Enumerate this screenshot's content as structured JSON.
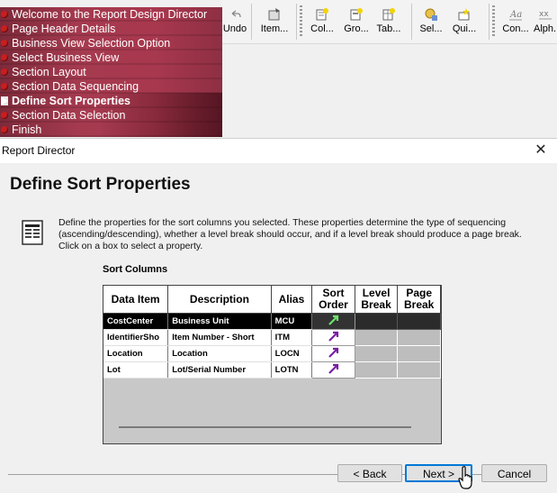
{
  "toolbar": {
    "buttons": [
      {
        "label": "Undo",
        "icon": "undo-icon"
      },
      {
        "label": "Item...",
        "icon": "item-icon"
      },
      {
        "label": "Col...",
        "icon": "columnar-icon"
      },
      {
        "label": "Gro...",
        "icon": "group-icon"
      },
      {
        "label": "Tab...",
        "icon": "tabular-icon"
      },
      {
        "label": "Sel...",
        "icon": "select-icon"
      },
      {
        "label": "Qui...",
        "icon": "quick-icon"
      },
      {
        "label": "Con...",
        "icon": "constant-icon"
      },
      {
        "label": "Alph...",
        "icon": "alpha-icon"
      }
    ]
  },
  "steps": {
    "items": [
      "Welcome to the Report Design Director",
      "Page Header Details",
      "Business View Selection Option",
      "Select Business View",
      "Section Layout",
      "Section Data Sequencing",
      "Define Sort Properties",
      "Section Data Selection",
      "Finish"
    ],
    "current_index": 6
  },
  "dialog": {
    "title": "Report Director",
    "page_title": "Define Sort Properties",
    "description": "Define the properties for the sort columns you selected.  These properties determine the type of sequencing (ascending/descending),  whether a level break should occur, and if a level break should produce a page break. Click on a box to select a property.",
    "sort_columns_label": "Sort Columns",
    "grid": {
      "headers": {
        "data_item": "Data Item",
        "description": "Description",
        "alias": "Alias",
        "sort_order": "Sort Order",
        "level_break": "Level Break",
        "page_break": "Page Break"
      },
      "rows": [
        {
          "data_item": "CostCenter",
          "description": "Business Unit",
          "alias": "MCU",
          "selected": true
        },
        {
          "data_item": "IdentifierSho",
          "description": "Item Number - Short",
          "alias": "ITM",
          "selected": false
        },
        {
          "data_item": "Location",
          "description": "Location",
          "alias": "LOCN",
          "selected": false
        },
        {
          "data_item": "Lot",
          "description": "Lot/Serial Number",
          "alias": "LOTN",
          "selected": false
        }
      ]
    },
    "buttons": {
      "back": "< Back",
      "next": "Next >",
      "cancel": "Cancel"
    }
  },
  "colors": {
    "navigator": "#a53a4f",
    "accent": "#0078d7",
    "arrow_selected": "#6ee36e",
    "arrow": "#7a1fa2"
  }
}
